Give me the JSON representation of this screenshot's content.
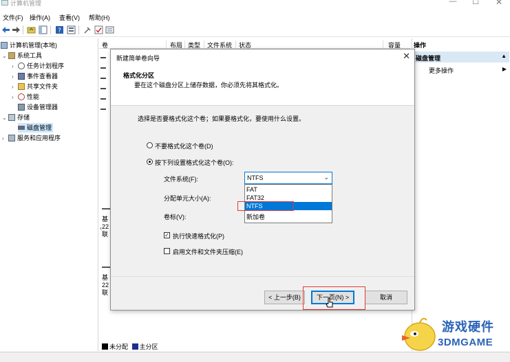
{
  "window": {
    "title": "计算机管理",
    "min": "—",
    "max": "☐",
    "close": "✕"
  },
  "menu": [
    "文件(F)",
    "操作(A)",
    "查看(V)",
    "帮助(H)"
  ],
  "tree": {
    "root": "计算机管理(本地)",
    "system_tools": "系统工具",
    "task_scheduler": "任务计划程序",
    "event_viewer": "事件查看器",
    "shared_folders": "共享文件夹",
    "performance": "性能",
    "device_manager": "设备管理器",
    "storage": "存储",
    "disk_management": "磁盘管理",
    "services_apps": "服务和应用程序"
  },
  "volume_list": {
    "columns": [
      "卷",
      "布局",
      "类型",
      "文件系统",
      "状态",
      "容量"
    ],
    "disks": [
      {
        "line1": "基",
        "line2": "22",
        "line3": "联"
      },
      {
        "line1": "基",
        "line2": "22",
        "line3": "联"
      }
    ],
    "legend": {
      "unallocated": "未分配",
      "primary": "主分区"
    }
  },
  "actions": {
    "header": "操作",
    "section": "磁盘管理",
    "more": "更多操作"
  },
  "wizard": {
    "title": "新建简单卷向导",
    "close": "✕",
    "heading": "格式化分区",
    "subheading": "要在这个磁盘分区上储存数据，你必须先将其格式化。",
    "prompt": "选择是否要格式化这个卷；如果要格式化，要使用什么设置。",
    "option_no_format": "不要格式化这个卷(D)",
    "option_format": "按下列设置格式化这个卷(O):",
    "fs_label": "文件系统(F):",
    "fs_value": "NTFS",
    "fs_options": [
      "FAT",
      "FAT32",
      "NTFS"
    ],
    "fs_list_tail": "新加卷",
    "alloc_label": "分配单元大小(A):",
    "volume_label_label": "卷标(V):",
    "quick_format": "执行快速格式化(P)",
    "compression": "启用文件和文件夹压缩(E)",
    "btn_back": "< 上一步(B)",
    "btn_next": "下一页(N) >",
    "btn_cancel": "取消"
  },
  "colors": {
    "accent": "#0078d7",
    "highlight_box": "#e23a3a",
    "unallocated": "#000000",
    "primary_partition": "#1f2f8f"
  },
  "watermark": {
    "cn": "游戏硬件",
    "en": "3DMGAME"
  }
}
